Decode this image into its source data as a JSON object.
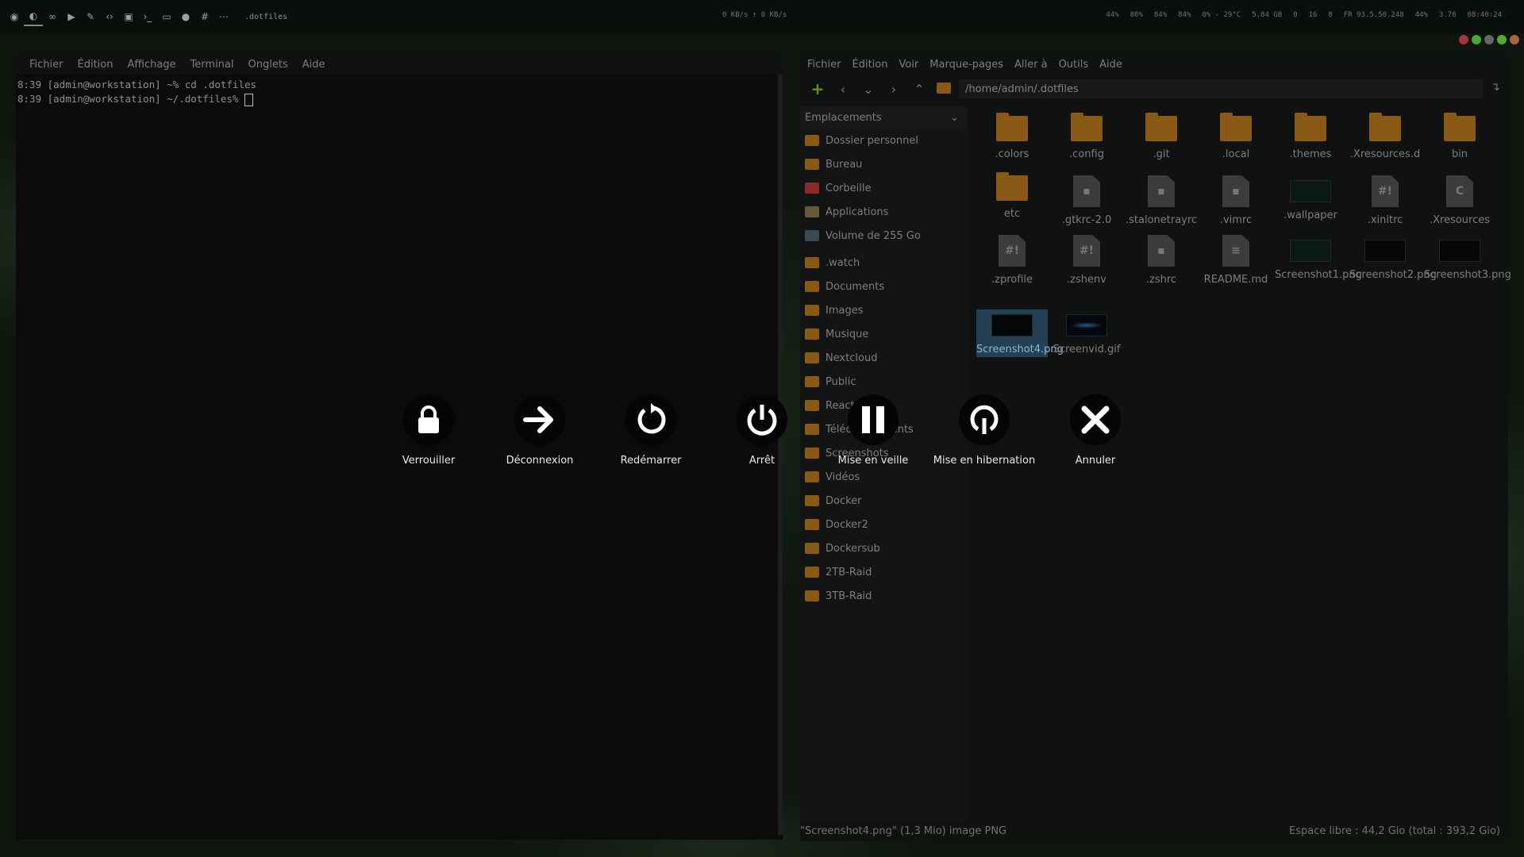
{
  "topbar": {
    "window_title": ".dotfiles",
    "net": "0 KB/s  ↑ 0 KB/s",
    "stats": [
      "44%",
      "88%",
      "84%",
      "84%",
      "0% - 29°C",
      "5.84 GB",
      "0",
      "16",
      "8",
      "FR 93.5.50.248",
      "44%",
      "3.76",
      "08:40:24"
    ]
  },
  "terminal": {
    "menu": [
      "Fichier",
      "Édition",
      "Affichage",
      "Terminal",
      "Onglets",
      "Aide"
    ],
    "lines": [
      "8:39 [admin@workstation] ~% cd .dotfiles",
      "8:39 [admin@workstation] ~/.dotfiles% "
    ]
  },
  "filemanager": {
    "menu": [
      "Fichier",
      "Édition",
      "Voir",
      "Marque-pages",
      "Aller à",
      "Outils",
      "Aide"
    ],
    "path": "/home/admin/.dotfiles",
    "side_header": "Emplacements",
    "places": [
      "Dossier personnel",
      "Bureau",
      "Corbeille",
      "Applications",
      "Volume de 255 Go"
    ],
    "bookmarks": [
      ".watch",
      "Documents",
      "Images",
      "Musique",
      "Nextcloud",
      "Public",
      "React",
      "Téléchargements",
      "Screenshots",
      "Vidéos",
      "Docker",
      "Docker2",
      "Dockersub",
      "2TB-Raid",
      "3TB-Raid"
    ],
    "files": [
      {
        "name": ".colors",
        "kind": "folder"
      },
      {
        "name": ".config",
        "kind": "folder"
      },
      {
        "name": ".git",
        "kind": "folder"
      },
      {
        "name": ".local",
        "kind": "folder"
      },
      {
        "name": ".themes",
        "kind": "folder"
      },
      {
        "name": ".Xresources.d",
        "kind": "folder"
      },
      {
        "name": "bin",
        "kind": "folder"
      },
      {
        "name": "etc",
        "kind": "folder"
      },
      {
        "name": ".gtkrc-2.0",
        "kind": "doc"
      },
      {
        "name": ".stalonetrayrc",
        "kind": "doc"
      },
      {
        "name": ".vimrc",
        "kind": "doc"
      },
      {
        "name": ".wallpaper",
        "kind": "img"
      },
      {
        "name": ".xinitrc",
        "kind": "script"
      },
      {
        "name": ".Xresources",
        "kind": "c"
      },
      {
        "name": ".zprofile",
        "kind": "script"
      },
      {
        "name": ".zshenv",
        "kind": "script"
      },
      {
        "name": ".zshrc",
        "kind": "doc"
      },
      {
        "name": "README.md",
        "kind": "text"
      },
      {
        "name": "Screenshot1.png",
        "kind": "img"
      },
      {
        "name": "Screenshot2.png",
        "kind": "img-dark"
      },
      {
        "name": "Screenshot3.png",
        "kind": "img-dark"
      },
      {
        "name": "Screenshot4.png",
        "kind": "img-dark",
        "selected": true
      },
      {
        "name": "Screenvid.gif",
        "kind": "img-blue"
      }
    ],
    "status_left": "\"Screenshot4.png\" (1,3 Mio) image PNG",
    "status_right": "Espace libre : 44,2 Gio (total : 393,2 Gio)"
  },
  "logout": {
    "options": [
      {
        "label": "Verrouiller",
        "icon": "lock-icon"
      },
      {
        "label": "Déconnexion",
        "icon": "arrow-right-icon"
      },
      {
        "label": "Redémarrer",
        "icon": "restart-icon"
      },
      {
        "label": "Arrêt",
        "icon": "power-icon"
      },
      {
        "label": "Mise en veille",
        "icon": "pause-icon"
      },
      {
        "label": "Mise en hibernation",
        "icon": "hibernate-icon"
      },
      {
        "label": "Annuler",
        "icon": "close-icon"
      }
    ]
  }
}
